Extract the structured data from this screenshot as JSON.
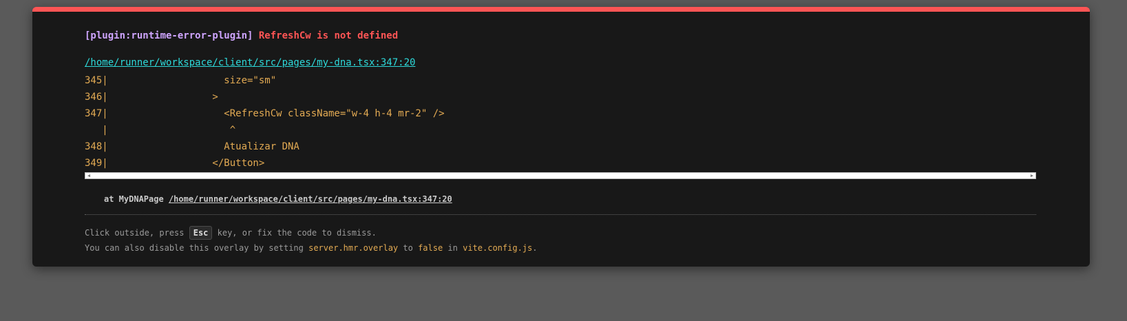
{
  "error": {
    "plugin": "[plugin:runtime-error-plugin]",
    "message": "RefreshCw is not defined",
    "file": "/home/runner/workspace/client/src/pages/my-dna.tsx:347:20",
    "frame": [
      "345|                    size=\"sm\"",
      "346|                  >",
      "347|                    <RefreshCw className=\"w-4 h-4 mr-2\" />",
      "   |                     ^",
      "348|                    Atualizar DNA",
      "349|                  </Button>"
    ],
    "stack": {
      "prefix": "at MyDNAPage",
      "link": "/home/runner/workspace/client/src/pages/my-dna.tsx:347:20"
    }
  },
  "tip": {
    "line1_before": "Click outside, press ",
    "line1_key": "Esc",
    "line1_after": " key, or fix the code to dismiss.",
    "line2_before": "You can also disable this overlay by setting ",
    "line2_code1": "server.hmr.overlay",
    "line2_mid1": " to ",
    "line2_code2": "false",
    "line2_mid2": " in ",
    "line2_code3": "vite.config.js",
    "line2_end": "."
  },
  "colors": {
    "accent_border": "#ff5555",
    "plugin": "#cfa5ff",
    "file_link": "#2dd9da",
    "code": "#e2aa53"
  },
  "icons": {
    "scroll_left": "scroll-left-arrow-icon",
    "scroll_right": "scroll-right-arrow-icon"
  }
}
